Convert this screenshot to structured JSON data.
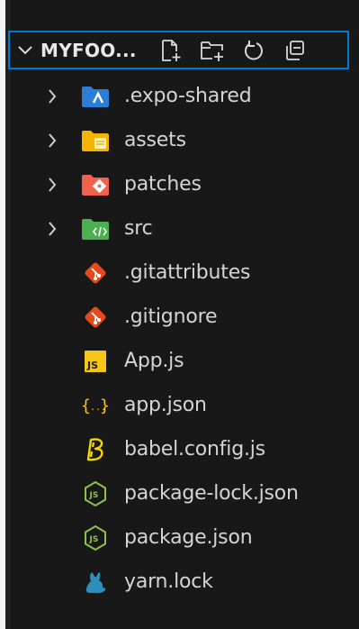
{
  "explorer": {
    "folder_title": "MYFOO...",
    "actions": [
      {
        "name": "new-file-icon"
      },
      {
        "name": "new-folder-icon"
      },
      {
        "name": "refresh-icon"
      },
      {
        "name": "collapse-all-icon"
      }
    ]
  },
  "items": [
    {
      "label": ".expo-shared",
      "kind": "folder",
      "icon": "expo-folder-icon",
      "color": "#2d7cd6"
    },
    {
      "label": "assets",
      "kind": "folder",
      "icon": "assets-folder-icon",
      "color": "#f4b400"
    },
    {
      "label": "patches",
      "kind": "folder",
      "icon": "patches-folder-icon",
      "color": "#f0624d"
    },
    {
      "label": "src",
      "kind": "folder",
      "icon": "src-folder-icon",
      "color": "#4caf50"
    },
    {
      "label": ".gitattributes",
      "kind": "file",
      "icon": "git-icon",
      "color": "#e64a19"
    },
    {
      "label": ".gitignore",
      "kind": "file",
      "icon": "git-icon",
      "color": "#e64a19"
    },
    {
      "label": "App.js",
      "kind": "file",
      "icon": "javascript-icon",
      "color": "#f5c518"
    },
    {
      "label": "app.json",
      "kind": "file",
      "icon": "json-icon",
      "color": "#f5c518"
    },
    {
      "label": "babel.config.js",
      "kind": "file",
      "icon": "babel-icon",
      "color": "#f5d400"
    },
    {
      "label": "package-lock.json",
      "kind": "file",
      "icon": "nodejs-icon",
      "color": "#8bc34a"
    },
    {
      "label": "package.json",
      "kind": "file",
      "icon": "nodejs-icon",
      "color": "#8bc34a"
    },
    {
      "label": "yarn.lock",
      "kind": "file",
      "icon": "yarn-icon",
      "color": "#2c8ebb"
    }
  ]
}
